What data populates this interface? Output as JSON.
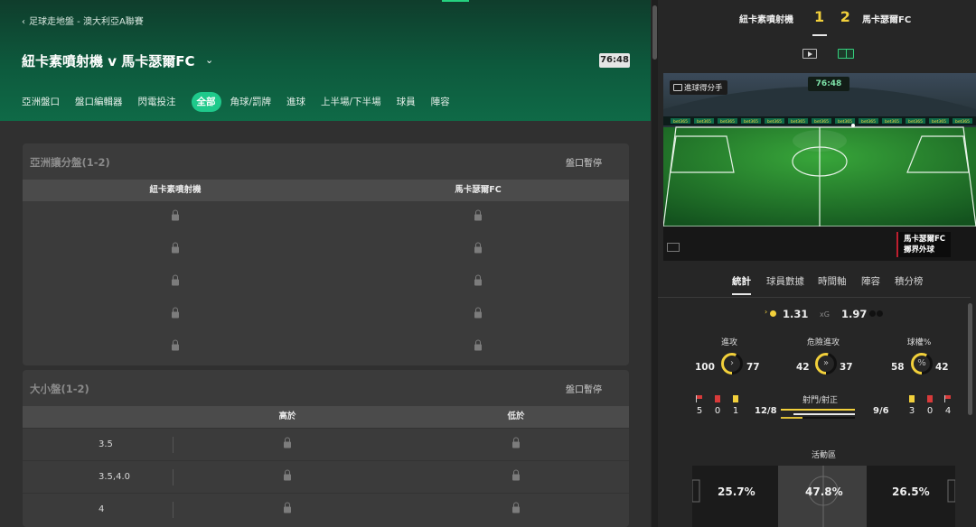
{
  "header": {
    "breadcrumb": "足球走地盤 - 澳大利亞A聯賽",
    "match_title": "紐卡素噴射機 v 馬卡瑟爾FC",
    "clock": "76:48"
  },
  "tabs": [
    {
      "label": "亞洲盤口",
      "active": false
    },
    {
      "label": "盤口編輯器",
      "active": false
    },
    {
      "label": "閃電投注",
      "active": false
    },
    {
      "label": "全部",
      "active": true
    },
    {
      "label": "角球/罰牌",
      "active": false
    },
    {
      "label": "進球",
      "active": false
    },
    {
      "label": "上半場/下半場",
      "active": false
    },
    {
      "label": "球員",
      "active": false
    },
    {
      "label": "陣容",
      "active": false
    }
  ],
  "asian_handicap": {
    "title": "亞洲讓分盤(1-2)",
    "status": "盤口暫停",
    "home": "紐卡素噴射機",
    "away": "馬卡瑟爾FC",
    "rows": 5
  },
  "over_under": {
    "title": "大小盤(1-2)",
    "status": "盤口暫停",
    "over": "高於",
    "under": "低於",
    "lines": [
      "3.5",
      "3.5,4.0",
      "4"
    ]
  },
  "scoreboard": {
    "home": "紐卡素噴射機",
    "away": "馬卡瑟爾FC",
    "home_score": "1",
    "away_score": "2",
    "score_text": "1 2"
  },
  "stage": {
    "label": "進球得分手",
    "clock": "76:48",
    "event_team": "馬卡瑟爾FC",
    "event_text": "擲界外球",
    "ad_text": "bet365"
  },
  "stats_tabs": [
    "統計",
    "球員數據",
    "時間軸",
    "陣容",
    "積分榜"
  ],
  "stats": {
    "xg_label": "xG",
    "xg_home": "1.31",
    "xg_away": "1.97",
    "attacks": {
      "label": "進攻",
      "home": "100",
      "away": "77",
      "home_share": 0.565
    },
    "dangerous_attacks": {
      "label": "危險進攻",
      "home": "42",
      "away": "37",
      "home_share": 0.532
    },
    "possession": {
      "label": "球權%",
      "home": "58",
      "away": "42",
      "home_share": 0.58
    },
    "home_corners": "5",
    "home_red": "0",
    "home_yellow": "1",
    "away_yellow": "3",
    "away_red": "0",
    "away_corners": "4",
    "shots_label": "射門/射正",
    "shots_home": "12/8",
    "shots_away": "9/6",
    "zone_label": "活動區",
    "zone_home": "25.7%",
    "zone_mid": "47.8%",
    "zone_away": "26.5%"
  },
  "colors": {
    "home": "#f2d03b",
    "away": "#111111",
    "accent": "#1fc98b",
    "red_card": "#d83a3a",
    "yellow_card": "#f2d03b"
  }
}
